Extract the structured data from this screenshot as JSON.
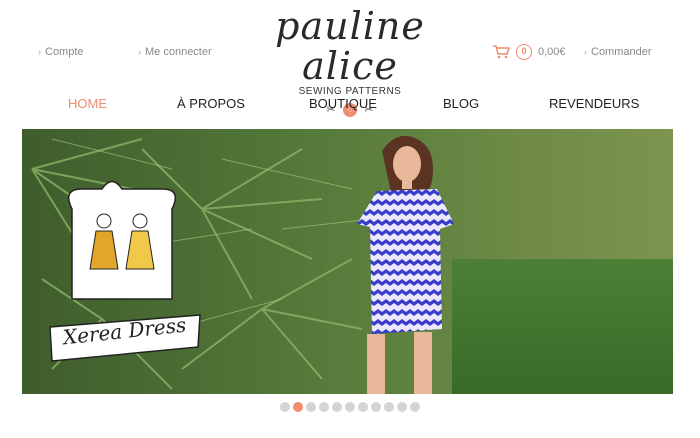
{
  "header": {
    "left_links": [
      {
        "label": "Compte"
      },
      {
        "label": "Me connecter"
      }
    ],
    "brand": {
      "name": "pauline alice",
      "tagline": "SEWING PATTERNS"
    },
    "cart": {
      "count": "0",
      "total": "0,00€"
    },
    "checkout_label": "Commander"
  },
  "nav": {
    "items": [
      {
        "label": "HOME",
        "active": true
      },
      {
        "label": "À PROPOS"
      },
      {
        "label": "BOUTIQUE"
      },
      {
        "label": "BLOG"
      },
      {
        "label": "REVENDEURS"
      }
    ]
  },
  "hero": {
    "caption": "Xerea Dress"
  },
  "carousel": {
    "slide_count": 11,
    "active_index": 1
  },
  "colors": {
    "accent": "#ef8b6e",
    "dot_inactive": "#d4d4d4"
  }
}
